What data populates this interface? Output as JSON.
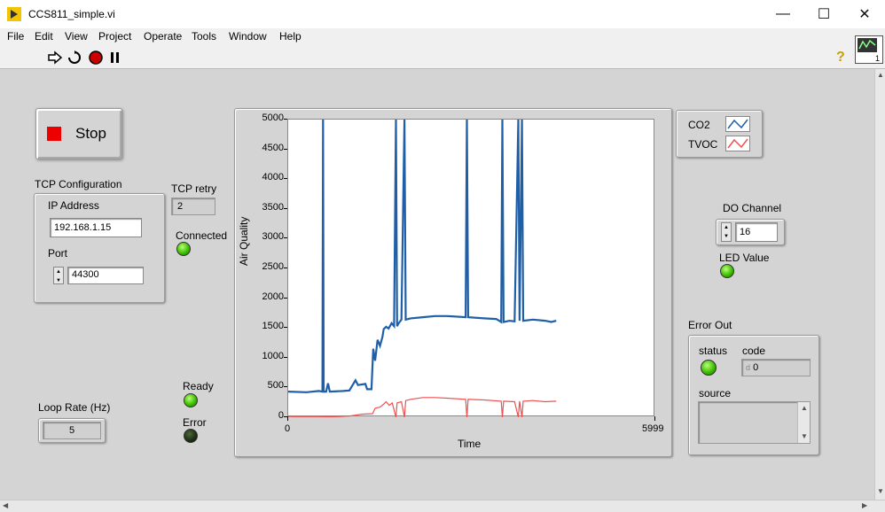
{
  "window": {
    "title": "CCS811_simple.vi",
    "minimize_icon": "minimize-icon",
    "maximize_icon": "maximize-icon",
    "close_icon": "close-icon"
  },
  "menu": [
    "File",
    "Edit",
    "View",
    "Project",
    "Operate",
    "Tools",
    "Window",
    "Help"
  ],
  "toolbar": {
    "run_icon": "run-arrow-icon",
    "run_continuous_icon": "run-continuously-icon",
    "abort_icon": "abort-icon",
    "pause_icon": "pause-icon",
    "help_label": "?"
  },
  "stop_button": {
    "label": "Stop"
  },
  "tcp_config": {
    "title": "TCP Configuration",
    "ip_label": "IP Address",
    "ip_value": "192.168.1.15",
    "port_label": "Port",
    "port_value": "44300"
  },
  "tcp_retry": {
    "label": "TCP retry",
    "value": "2"
  },
  "connected": {
    "label": "Connected",
    "state": true
  },
  "loop_rate": {
    "label": "Loop Rate (Hz)",
    "value": "5"
  },
  "ready": {
    "label": "Ready",
    "state": true
  },
  "error_led": {
    "label": "Error",
    "state": false
  },
  "legend": {
    "co2_label": "CO2",
    "tvoc_label": "TVOC",
    "co2_color": "#1f5fa8",
    "tvoc_color": "#f05050"
  },
  "do_channel": {
    "label": "DO Channel",
    "value": "16"
  },
  "led_value": {
    "label": "LED Value",
    "state": true
  },
  "error_out": {
    "title": "Error Out",
    "status_label": "status",
    "code_label": "code",
    "code_value": "0",
    "code_prefix": "d",
    "source_label": "source",
    "status": true
  },
  "chart_data": {
    "type": "line",
    "xlabel": "Time",
    "ylabel": "Air Quality",
    "xlim": [
      0,
      5999
    ],
    "ylim": [
      0,
      5000
    ],
    "x_ticks": [
      "0",
      "5999"
    ],
    "y_ticks": [
      "0",
      "500",
      "1000",
      "1500",
      "2000",
      "2500",
      "3000",
      "3500",
      "4000",
      "4500",
      "5000"
    ],
    "series": [
      {
        "name": "CO2",
        "color": "#1f5fa8",
        "points": [
          [
            0,
            430
          ],
          [
            300,
            420
          ],
          [
            500,
            440
          ],
          [
            560,
            430
          ],
          [
            570,
            5000
          ],
          [
            580,
            430
          ],
          [
            620,
            430
          ],
          [
            650,
            570
          ],
          [
            680,
            430
          ],
          [
            900,
            440
          ],
          [
            1000,
            450
          ],
          [
            1100,
            620
          ],
          [
            1140,
            540
          ],
          [
            1260,
            560
          ],
          [
            1290,
            470
          ],
          [
            1360,
            470
          ],
          [
            1390,
            1150
          ],
          [
            1420,
            950
          ],
          [
            1460,
            1300
          ],
          [
            1500,
            1200
          ],
          [
            1540,
            1350
          ],
          [
            1560,
            1480
          ],
          [
            1600,
            1520
          ],
          [
            1640,
            1490
          ],
          [
            1690,
            1580
          ],
          [
            1730,
            1530
          ],
          [
            1760,
            5000
          ],
          [
            1780,
            1530
          ],
          [
            1800,
            1570
          ],
          [
            1850,
            1640
          ],
          [
            1900,
            5000
          ],
          [
            1920,
            1640
          ],
          [
            2000,
            1660
          ],
          [
            2200,
            1680
          ],
          [
            2400,
            1700
          ],
          [
            2600,
            1700
          ],
          [
            2900,
            1680
          ],
          [
            2920,
            5000
          ],
          [
            2940,
            1680
          ],
          [
            3200,
            1660
          ],
          [
            3400,
            1650
          ],
          [
            3480,
            1600
          ],
          [
            3500,
            5000
          ],
          [
            3520,
            1600
          ],
          [
            3620,
            1620
          ],
          [
            3700,
            1610
          ],
          [
            3760,
            5000
          ],
          [
            3780,
            1620
          ],
          [
            3820,
            5000
          ],
          [
            3840,
            1620
          ],
          [
            4000,
            1640
          ],
          [
            4200,
            1620
          ],
          [
            4300,
            1600
          ],
          [
            4380,
            1620
          ]
        ]
      },
      {
        "name": "TVOC",
        "color": "#f05050",
        "points": [
          [
            0,
            5
          ],
          [
            500,
            5
          ],
          [
            800,
            10
          ],
          [
            1000,
            20
          ],
          [
            1200,
            50
          ],
          [
            1380,
            60
          ],
          [
            1420,
            150
          ],
          [
            1500,
            170
          ],
          [
            1560,
            220
          ],
          [
            1600,
            260
          ],
          [
            1650,
            200
          ],
          [
            1700,
            240
          ],
          [
            1760,
            0
          ],
          [
            1780,
            240
          ],
          [
            1850,
            260
          ],
          [
            1900,
            0
          ],
          [
            1920,
            280
          ],
          [
            2000,
            300
          ],
          [
            2200,
            330
          ],
          [
            2400,
            330
          ],
          [
            2600,
            320
          ],
          [
            2900,
            300
          ],
          [
            2920,
            0
          ],
          [
            2940,
            300
          ],
          [
            3200,
            290
          ],
          [
            3480,
            270
          ],
          [
            3500,
            0
          ],
          [
            3520,
            270
          ],
          [
            3700,
            260
          ],
          [
            3760,
            0
          ],
          [
            3780,
            270
          ],
          [
            3820,
            0
          ],
          [
            3840,
            270
          ],
          [
            4000,
            280
          ],
          [
            4200,
            260
          ],
          [
            4380,
            270
          ]
        ]
      }
    ]
  }
}
